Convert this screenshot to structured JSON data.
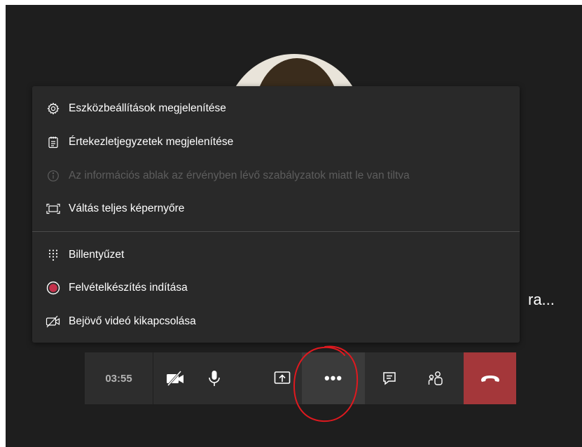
{
  "menu": {
    "items": [
      {
        "label": "Eszközbeállítások megjelenítése",
        "icon": "gear-icon",
        "enabled": true
      },
      {
        "label": "Értekezletjegyzetek megjelenítése",
        "icon": "notes-icon",
        "enabled": true
      },
      {
        "label": "Az információs ablak az érvényben lévő szabályzatok miatt le van tiltva",
        "icon": "info-icon",
        "enabled": false
      },
      {
        "label": "Váltás teljes képernyőre",
        "icon": "fullscreen-icon",
        "enabled": true
      },
      {
        "label": "Billentyűzet",
        "icon": "dialpad-icon",
        "enabled": true
      },
      {
        "label": "Felvételkészítés indítása",
        "icon": "record-icon",
        "enabled": true
      },
      {
        "label": "Bejövő videó kikapcsolása",
        "icon": "video-off-icon",
        "enabled": true
      }
    ]
  },
  "participant": {
    "name_truncated": "ra..."
  },
  "toolbar": {
    "timer": "03:55",
    "more_label": "•••",
    "buttons": [
      "video-off-icon",
      "microphone-icon",
      "share-screen-icon",
      "more-options-icon",
      "chat-icon",
      "participants-icon",
      "hang-up-icon"
    ]
  },
  "colors": {
    "background": "#1e1e1e",
    "menu": "#292929",
    "toolbar": "#2d2d2d",
    "hangup": "#a4373a",
    "record": "#c4314b",
    "annotation": "#e0191f"
  }
}
